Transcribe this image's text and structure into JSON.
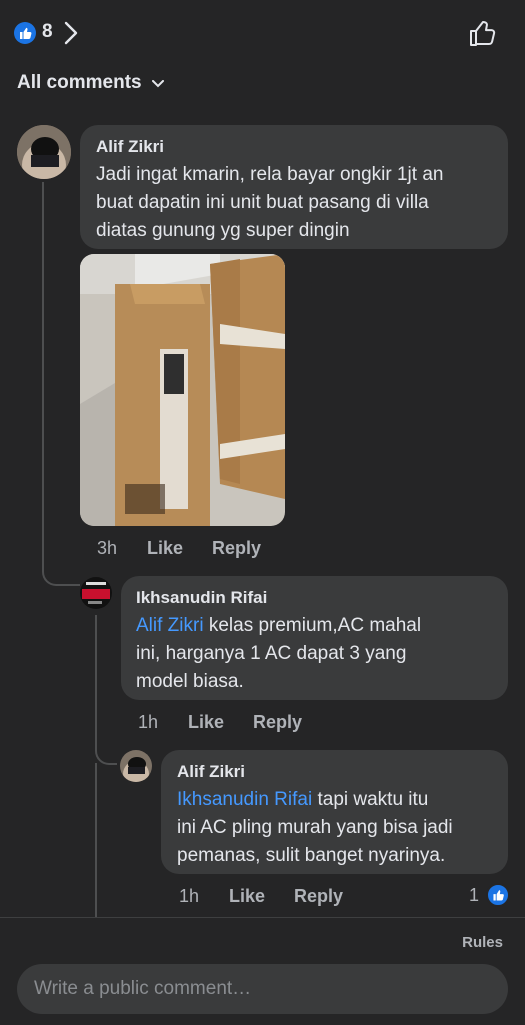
{
  "header": {
    "reaction_count": "8",
    "filter_label": "All comments"
  },
  "comments": [
    {
      "author": "Alif Zikri",
      "text_lines": [
        "Jadi ingat kmarin, rela bayar ongkir 1jt an",
        "buat dapatin ini unit buat pasang di villa",
        "diatas gunung yg super dingin"
      ],
      "time": "3h",
      "like_label": "Like",
      "reply_label": "Reply"
    },
    {
      "author": "Ikhsanudin Rifai",
      "mention": "Alif Zikri",
      "text_lines": [
        " kelas premium,AC mahal",
        "ini, harganya 1  AC dapat 3 yang",
        "model biasa."
      ],
      "time": "1h",
      "like_label": "Like",
      "reply_label": "Reply"
    },
    {
      "author": "Alif Zikri",
      "mention": "Ikhsanudin Rifai",
      "text_lines": [
        " tapi waktu itu",
        "ini AC pling murah yang bisa jadi",
        "pemanas, sulit banget nyarinya."
      ],
      "time": "1h",
      "like_label": "Like",
      "reply_label": "Reply",
      "reaction_count": "1"
    }
  ],
  "footer": {
    "rules_label": "Rules",
    "input_placeholder": "Write a public comment…"
  },
  "colors": {
    "background": "#252526",
    "bubble": "#3a3b3c",
    "mention": "#4599ff",
    "like_blue": "#1b74e4"
  }
}
